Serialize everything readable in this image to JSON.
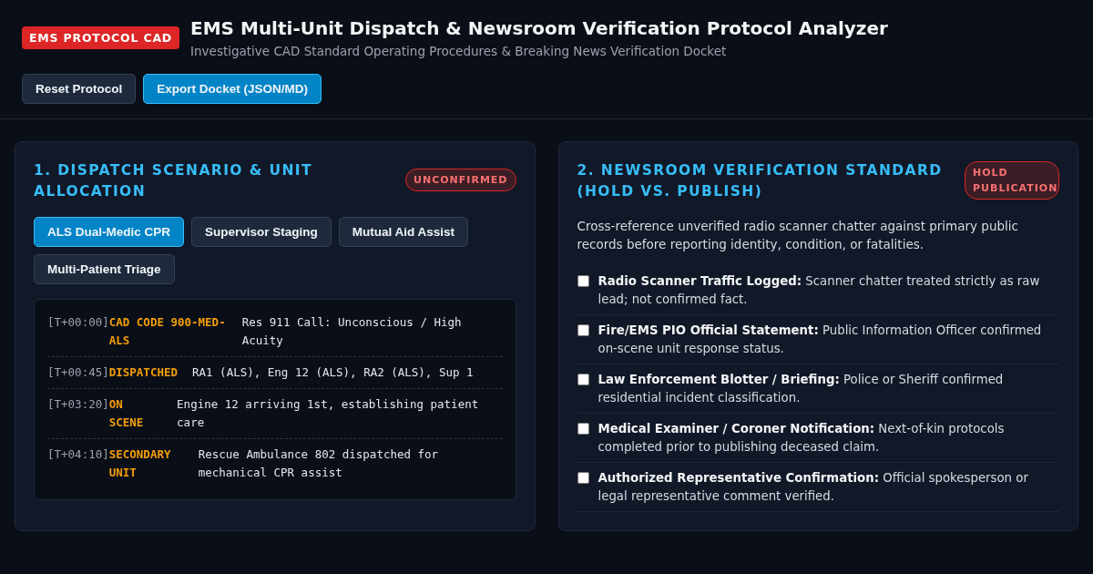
{
  "header": {
    "badge": "EMS PROTOCOL CAD",
    "title": "EMS Multi-Unit Dispatch & Newsroom Verification Protocol Analyzer",
    "subtitle": "Investigative CAD Standard Operating Procedures & Breaking News Verification Docket",
    "actions": [
      {
        "label": "Reset Protocol",
        "kind": "secondary"
      },
      {
        "label": "Export Docket (JSON/MD)",
        "kind": "primary"
      }
    ]
  },
  "dispatch": {
    "title": "1. DISPATCH SCENARIO & UNIT ALLOCATION",
    "status": "UNCONFIRMED",
    "scenarios": [
      {
        "label": "ALS Dual-Medic CPR",
        "selected": true
      },
      {
        "label": "Supervisor Staging",
        "selected": false
      },
      {
        "label": "Mutual Aid Assist",
        "selected": false
      },
      {
        "label": "Multi-Patient Triage",
        "selected": false
      }
    ],
    "log": [
      {
        "time": "[T+00:00]",
        "code": "CAD CODE 900-MED-ALS",
        "text": "Res 911 Call: Unconscious / High Acuity"
      },
      {
        "time": "[T+00:45]",
        "code": "DISPATCHED",
        "text": "RA1 (ALS), Eng 12 (ALS), RA2 (ALS), Sup 1"
      },
      {
        "time": "[T+03:20]",
        "code": "ON SCENE",
        "text": "Engine 12 arriving 1st, establishing patient care"
      },
      {
        "time": "[T+04:10]",
        "code": "SECONDARY UNIT",
        "text": "Rescue Ambulance 802 dispatched for mechanical CPR assist"
      }
    ]
  },
  "verification": {
    "title": "2. NEWSROOM VERIFICATION STANDARD (HOLD VS. PUBLISH)",
    "status": "HOLD PUBLICATION",
    "intro": "Cross-reference unverified radio scanner chatter against primary public records before reporting identity, condition, or fatalities.",
    "checks": [
      {
        "text": "**Radio Scanner Traffic Logged:** Scanner chatter treated strictly as raw lead; not confirmed fact.",
        "checked": false
      },
      {
        "text": "**Fire/EMS PIO Official Statement:** Public Information Officer confirmed on-scene unit response status.",
        "checked": false
      },
      {
        "text": "**Law Enforcement Blotter / Briefing:** Police or Sheriff confirmed residential incident classification.",
        "checked": false
      },
      {
        "text": "**Medical Examiner / Coroner Notification:** Next-of-kin protocols completed prior to publishing deceased claim.",
        "checked": false
      },
      {
        "text": "**Authorized Representative Confirmation:** Official spokesperson or legal representative comment verified.",
        "checked": false
      }
    ]
  }
}
